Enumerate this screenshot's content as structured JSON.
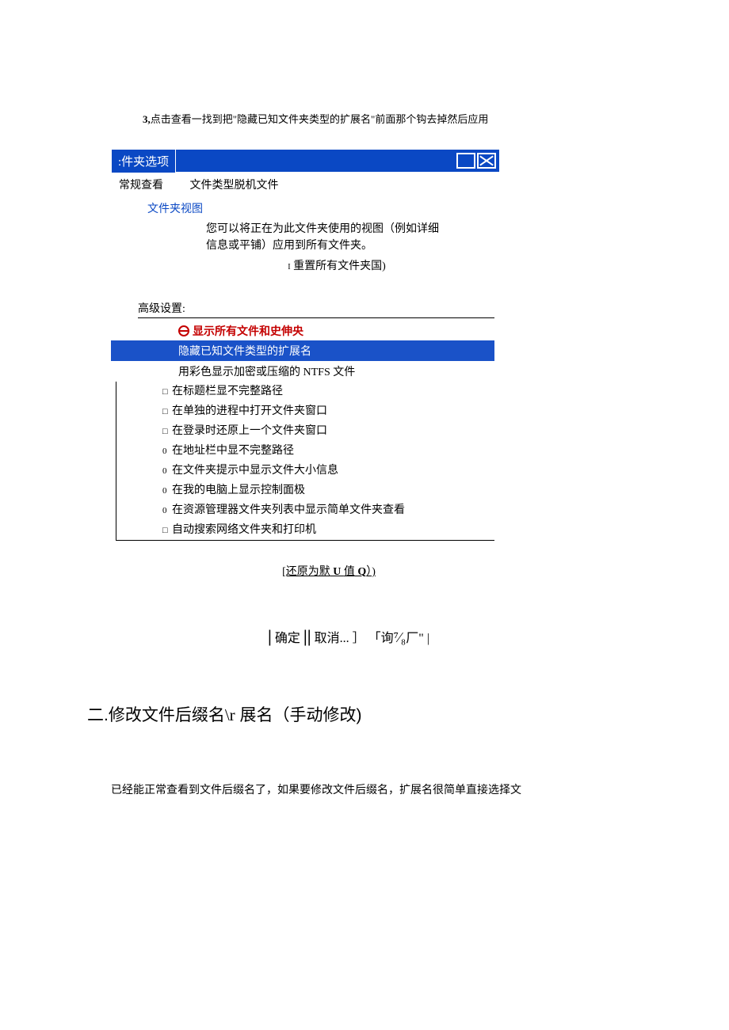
{
  "intro": {
    "num": "3,",
    "text": "点击查看一找到把\"隐藏已知文件夹类型的扩展名\"前面那个钩去掉然后应用"
  },
  "titlebar": {
    "title": ":件夹选项"
  },
  "tabs": {
    "tab1": "常规查看",
    "tab2": "文件类型脱机文件"
  },
  "folderView": {
    "label": "文件夹视图",
    "desc1": "您可以将正在为此文件夹使用的视图（例如详细",
    "desc2": "信息或平铺）应用到所有文件夹。",
    "reset_i": "I",
    "reset": "重置所有文件夹国)"
  },
  "advanced": {
    "label": "高级设置:",
    "showAll": "显示所有文件和史伸央",
    "hideExt": "隐藏已知文件类型的扩展名",
    "ntfs_pre": "用彩色显示加密或压缩的",
    "ntfs_mid": " NTFS ",
    "ntfs_post": "文件",
    "options": [
      {
        "prefix": "□",
        "text": "在标题栏显不完整路径"
      },
      {
        "prefix": "□",
        "text": "在单独的进程中打开文件夹窗口"
      },
      {
        "prefix": "□",
        "text": "在登录时还原上一个文件夹窗口"
      },
      {
        "prefix": "0",
        "text": "在地址栏中显不完整路径"
      },
      {
        "prefix": "0",
        "text": "在文件夹提示中显示文件大小信息"
      },
      {
        "prefix": "0",
        "text": "在我的电脑上显示控制面极"
      },
      {
        "prefix": "0",
        "text": "在资源管理器文件夹列表中显示简单文件夹查看"
      },
      {
        "prefix": "□",
        "text": "自动搜索网络文件夹和打印机"
      }
    ]
  },
  "restore": {
    "pre": "[还原为默",
    "u": " U ",
    "mid": "值",
    "q": " Q",
    "post": "）)"
  },
  "buttons": {
    "ok": "确定",
    "cancel": "取消...",
    "apply_open": "］  「询",
    "frac": "⁷⁄₈",
    "apply_close": "厂\" |"
  },
  "section2": {
    "title_pre": "二.修改文件后缀名",
    "title_r": "\\r",
    "title_post": " 展名（手动修改)",
    "body": "已经能正常查看到文件后缀名了，如果要修改文件后缀名，扩展名很简单直接选择文"
  }
}
